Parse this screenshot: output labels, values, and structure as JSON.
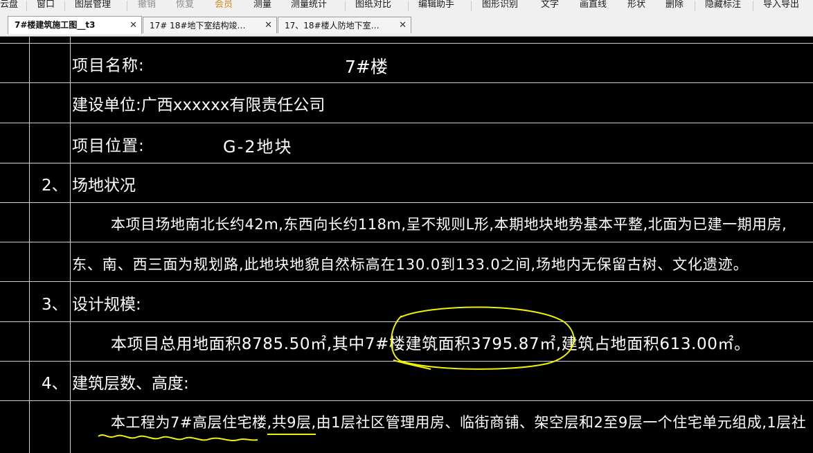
{
  "menubar": {
    "items": [
      "云盘",
      "窗口",
      "图层管理",
      "撤销",
      "恢复",
      "会员",
      "测量",
      "测量统计",
      "图纸对比",
      "编辑助手",
      "图形识别",
      "文字",
      "画直线",
      "形状",
      "删除",
      "隐藏标注",
      "导入导出"
    ]
  },
  "tabs": [
    {
      "label": "7#楼建筑施工图__t3",
      "close": "✕",
      "active": true
    },
    {
      "label": "17# 18#地下室结构竣…",
      "close": "✕",
      "active": false
    },
    {
      "label": "17、18#楼人防地下室…",
      "close": "✕",
      "active": false
    }
  ],
  "drawing": {
    "rows": [
      {
        "texts": [
          {
            "t": "项目名称:"
          },
          {
            "t": "7#楼"
          }
        ]
      },
      {
        "texts": [
          {
            "t": "建设单位:广西xxxxxx有限责任公司"
          }
        ]
      },
      {
        "texts": [
          {
            "t": "项目位置:"
          },
          {
            "t": "G-2地块"
          }
        ]
      },
      {
        "texts": [
          {
            "t": "2、"
          },
          {
            "t": "场地状况"
          }
        ]
      },
      {
        "texts": [
          {
            "t": "本项目场地南北长约42m,东西向长约118m,呈不规则L形,本期地块地势基本平整,北面为已建一期用房,"
          }
        ]
      },
      {
        "texts": [
          {
            "t": "东、南、西三面为规划路,此地块地貌自然标高在130.0到133.0之间,场地内无保留古树、文化遗迹。"
          }
        ]
      },
      {
        "texts": [
          {
            "t": "3、"
          },
          {
            "t": "设计规模:"
          }
        ]
      },
      {
        "texts": [
          {
            "t": "本项目总用地面积8785.50㎡,其中7#楼建筑面积3795.87㎡,建筑占地面积613.00㎡。"
          }
        ]
      },
      {
        "texts": [
          {
            "t": "4、"
          },
          {
            "t": "建筑层数、高度:"
          }
        ]
      },
      {
        "texts": [
          {
            "t": "本工程为7#高层住宅楼,共9层,由1层社区管理用房、临街商铺、架空层和2至9层一个住宅单元组成,1层社"
          }
        ]
      }
    ]
  },
  "colors": {
    "background": "#000000",
    "cad_text": "#ffffff",
    "grid_lines": "#cfcfcf",
    "annotation_yellow": "#f2f200"
  }
}
